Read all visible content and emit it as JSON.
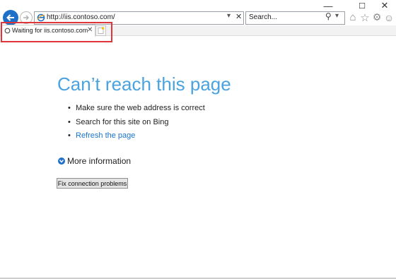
{
  "window": {
    "minimize_glyph": "—",
    "maximize_glyph": "☐",
    "close_glyph": "✕"
  },
  "toolbar": {
    "address_value": "http://iis.contoso.com/",
    "address_dropdown_glyph": "▾",
    "address_stop_glyph": "✕",
    "search_placeholder": "Search...",
    "search_glyph": "⚲",
    "search_dropdown_glyph": "▾",
    "home_glyph": "⌂",
    "favorites_glyph": "☆",
    "tools_glyph": "⚙",
    "feedback_glyph": "☺"
  },
  "tab": {
    "label": "Waiting for iis.contoso.com",
    "close_glyph": "✕"
  },
  "page": {
    "heading": "Can’t reach this page",
    "bullets": [
      "Make sure the web address is correct",
      "Search for this site on Bing",
      "Refresh the page"
    ],
    "more_info": "More information",
    "fix_button": "Fix connection problems"
  },
  "colors": {
    "accent": "#1e6fc8",
    "heading": "#4aa3df",
    "highlight": "#e0353b"
  }
}
